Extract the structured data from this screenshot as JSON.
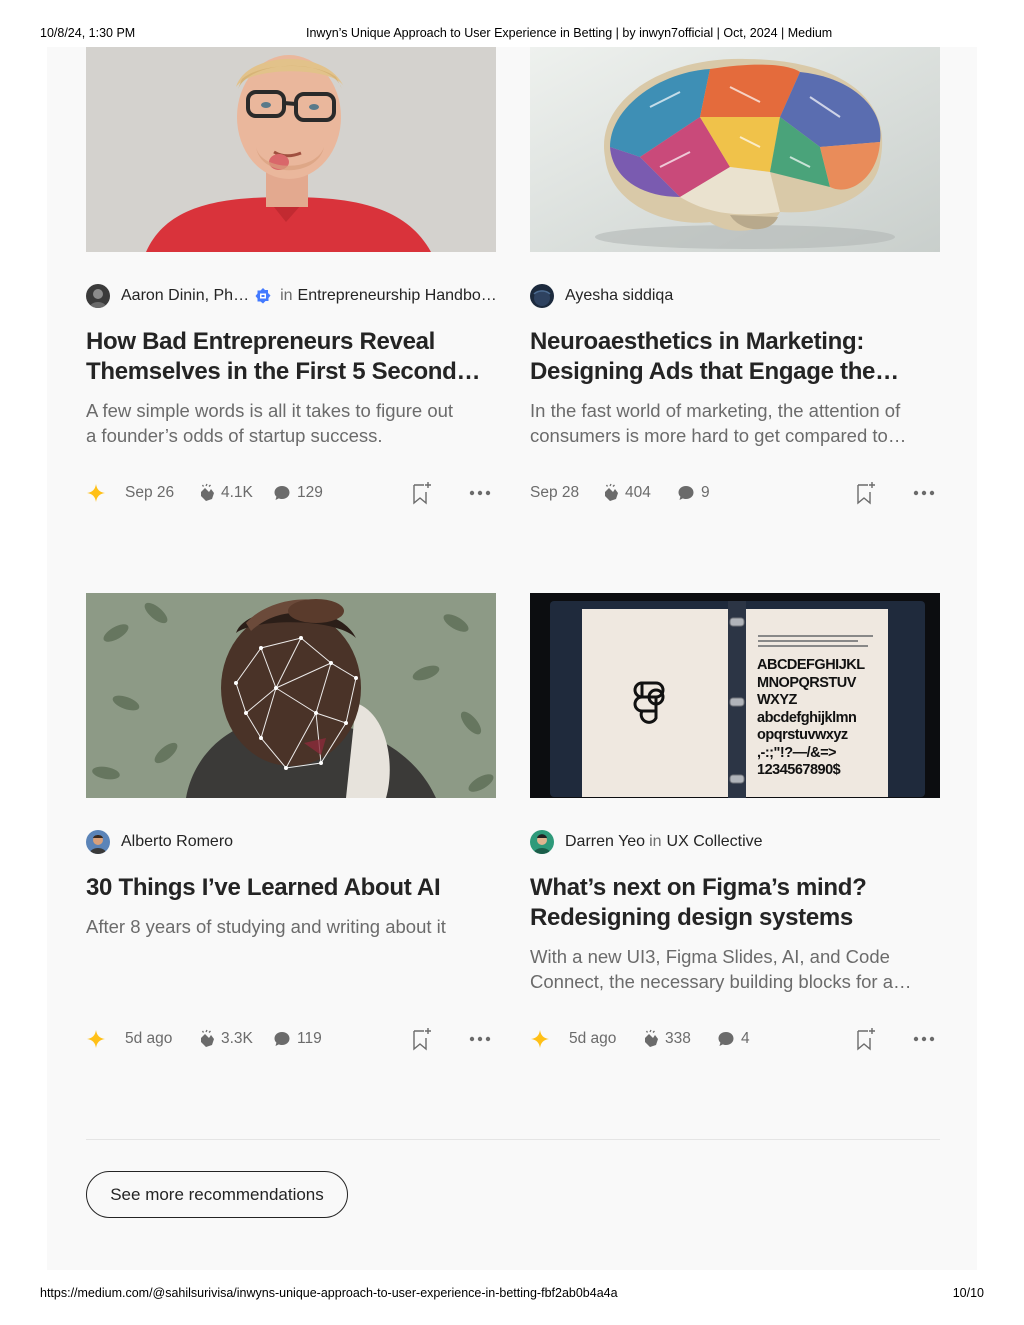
{
  "print_header": {
    "date": "10/8/24, 1:30 PM",
    "title": "Inwyn’s Unique Approach to User Experience in Betting | by inwyn7official | Oct, 2024 | Medium"
  },
  "print_footer": {
    "url": "https://medium.com/@sahilsurivisa/inwyns-unique-approach-to-user-experience-in-betting-fbf2ab0b4a4a",
    "page": "10/10"
  },
  "colors": {
    "member_star": "#ffc017",
    "badge_blue": "#437aff",
    "text": "#242424",
    "muted": "#6b6b6b"
  },
  "cards": [
    {
      "author": "Aaron Dinin, Ph…",
      "verified": true,
      "in_word": "in",
      "publication": "Entrepreneurship Handbo…",
      "title_lines": [
        "How Bad Entrepreneurs Reveal",
        "Themselves in the First 5 Second…"
      ],
      "subtitle_lines": [
        "A few simple words is all it takes to figure out",
        "a founder’s odds of startup success."
      ],
      "member_only": true,
      "date": "Sep 26",
      "claps": "4.1K",
      "responses": "129",
      "image_icon": "man-with-glasses-photo"
    },
    {
      "author": "Ayesha siddiqa",
      "title_lines": [
        "Neuroaesthetics in Marketing:",
        "Designing Ads that Engage the…"
      ],
      "subtitle_lines": [
        "In the fast world of marketing, the attention of",
        "consumers is more hard to get compared to…"
      ],
      "member_only": false,
      "date": "Sep 28",
      "claps": "404",
      "responses": "9",
      "image_icon": "colorful-paper-brain-photo"
    },
    {
      "author": "Alberto Romero",
      "title_lines": [
        "30 Things I’ve Learned About AI"
      ],
      "subtitle_lines": [
        "After 8 years of studying and writing about it"
      ],
      "member_only": true,
      "date": "5d ago",
      "claps": "3.3K",
      "responses": "119",
      "image_icon": "face-mesh-photo"
    },
    {
      "author": "Darren Yeo",
      "in_word": "in",
      "publication": "UX Collective",
      "title_lines": [
        "What’s next on Figma’s mind?",
        "Redesigning design systems"
      ],
      "subtitle_lines": [
        "With a new UI3, Figma Slides, AI, and Code",
        "Connect, the necessary building blocks for a…"
      ],
      "member_only": true,
      "date": "5d ago",
      "claps": "338",
      "responses": "4",
      "image_icon": "figma-binder-photo",
      "binder_text": [
        "ABCDEFGHIJKL",
        "MNOPQRSTUV",
        "WXYZ",
        "abcdefghijklmn",
        "opqrstuvwxyz",
        ",-:;\"!?—/&=>",
        "1234567890$"
      ]
    }
  ],
  "see_more_label": "See more recommendations"
}
